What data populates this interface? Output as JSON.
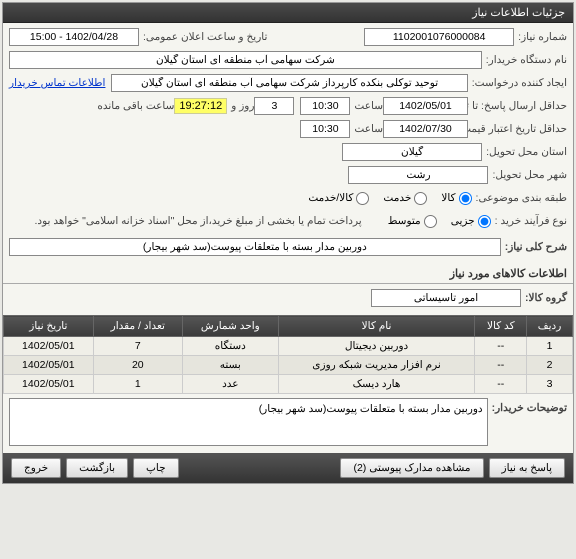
{
  "header": {
    "title": "جزئیات اطلاعات نیاز"
  },
  "form": {
    "need_no_label": "شماره نیاز:",
    "need_no": "1102001076000084",
    "announce_label": "تاریخ و ساعت اعلان عمومی:",
    "announce_value": "1402/04/28 - 15:00",
    "buyer_label": "نام دستگاه خریدار:",
    "buyer_value": "شرکت سهامی آب منطقه ای استان گیلان",
    "creator_label": "ایجاد کننده درخواست:",
    "creator_value": "توحید توکلی بنکده کارپرداز شرکت سهامی آب منطقه ای استان گیلان",
    "contact_link": "اطلاعات تماس خریدار",
    "deadline_label": "حداقل ارسال پاسخ: تا تاریخ:",
    "deadline_date": "1402/05/01",
    "time_label": "ساعت",
    "deadline_time": "10:30",
    "remaining_days": "3",
    "remaining_days_label": "روز و",
    "remaining_time": "19:27:12",
    "remaining_suffix": "ساعت باقی مانده",
    "validity_label": "حداقل تاریخ اعتبار قیمت: تا تاریخ:",
    "validity_date": "1402/07/30",
    "validity_time": "10:30",
    "province_label": "استان محل تحویل:",
    "province_value": "گیلان",
    "city_label": "شهر محل تحویل:",
    "city_value": "رشت",
    "category_label": "طبقه بندی موضوعی:",
    "radio_goods": "کالا",
    "radio_service": "خدمت",
    "radio_both": "کالا/خدمت",
    "process_label": "نوع فرآیند خرید :",
    "radio_partial": "جزیی",
    "radio_medium": "متوسط",
    "process_note": "پرداخت تمام یا بخشی از مبلغ خرید،از محل \"اسناد خزانه اسلامی\" خواهد بود.",
    "desc_label": "شرح کلی نیاز:",
    "desc_value": "دوربین مدار بسته با متعلقات پیوست(سد شهر بیجار)",
    "items_section": "اطلاعات کالاهای مورد نیاز",
    "group_label": "گروه کالا:",
    "group_value": "امور تاسیساتی"
  },
  "table": {
    "headers": [
      "ردیف",
      "کد کالا",
      "نام کالا",
      "واحد شمارش",
      "تعداد / مقدار",
      "تاریخ نیاز"
    ],
    "rows": [
      {
        "idx": "1",
        "code": "--",
        "name": "دوربین دیجیتال",
        "unit": "دستگاه",
        "qty": "7",
        "date": "1402/05/01"
      },
      {
        "idx": "2",
        "code": "--",
        "name": "نرم افزار مدیریت شبکه روزی",
        "unit": "بسته",
        "qty": "20",
        "date": "1402/05/01"
      },
      {
        "idx": "3",
        "code": "--",
        "name": "هارد دیسک",
        "unit": "عدد",
        "qty": "1",
        "date": "1402/05/01"
      }
    ]
  },
  "notes": {
    "label": "توضیحات خریدار:",
    "value": "دوربین مدار بسته با متعلقات پیوست(سد شهر بیجار)"
  },
  "footer": {
    "reply": "پاسخ به نیاز",
    "docs": "مشاهده مدارک پیوستی (2)",
    "print": "چاپ",
    "back": "بازگشت",
    "exit": "خروج"
  }
}
